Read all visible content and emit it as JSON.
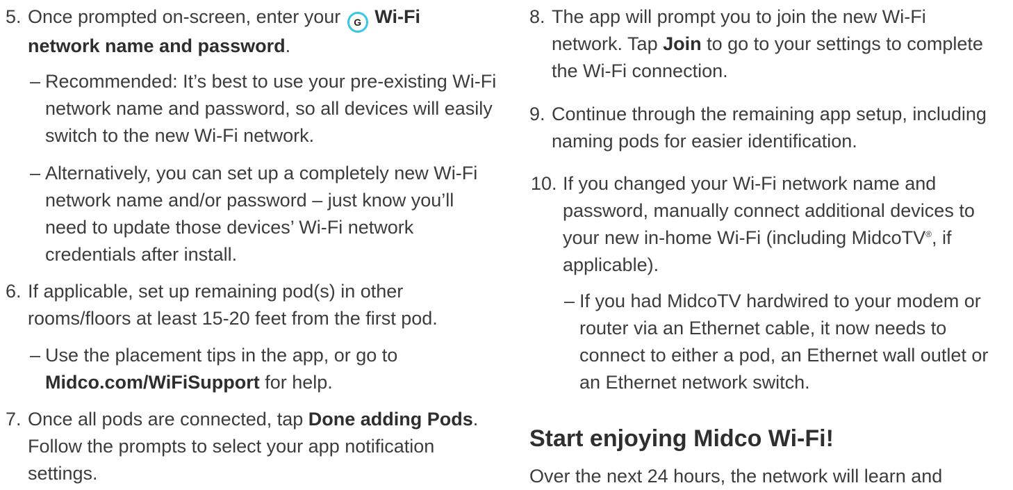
{
  "left": {
    "step5": {
      "num": "5.",
      "text_before": "Once prompted on-screen, enter your",
      "icon_letter": "G",
      "bold_1": "Wi-Fi",
      "bold_2": "network name and password",
      "text_after": "."
    },
    "step5_subs": [
      "Recommended: It’s best to use your pre-existing Wi-Fi network name and password, so all devices will easily switch to the new Wi-Fi network.",
      "Alternatively, you can set up a completely new Wi-Fi network name and/or password – just know you’ll need to update those devices’ Wi-Fi network credentials after install."
    ],
    "step6": {
      "num": "6.",
      "text": "If applicable, set up remaining pod(s) in other rooms/floors at least 15-20 feet from the first pod."
    },
    "step6_sub": {
      "text_before": "Use the placement tips in the app, or go to",
      "bold": "Midco.com/WiFiSupport",
      "text_after": "for help."
    },
    "step7": {
      "num": "7.",
      "text_before": "Once all pods are connected, tap",
      "bold": "Done adding Pods",
      "text_after": ". Follow the prompts to select your app notification settings."
    }
  },
  "right": {
    "step8": {
      "num": "8.",
      "text_before": "The app will prompt you to join the new Wi-Fi network. Tap",
      "bold": "Join",
      "text_after": "to go to your settings to complete the Wi-Fi connection."
    },
    "step9": {
      "num": "9.",
      "text": "Continue through the remaining app setup, including naming pods for easier identification."
    },
    "step10": {
      "num": "10.",
      "text_before": "If you changed your Wi-Fi network name and password, manually connect additional devices to your new in-home Wi-Fi (including MidcoTV",
      "reg": "®",
      "text_after": ", if applicable)."
    },
    "step10_sub": "If you had MidcoTV hardwired to your modem or router via an Ethernet cable, it now needs to connect to either a pod, an Ethernet wall outlet or an Ethernet network switch.",
    "heading": "Start enjoying Midco Wi-Fi!",
    "closing_text": "Over the next 24 hours, the network will learn and"
  },
  "dash_glyph": "–",
  "colors": {
    "text": "#3c3c3c",
    "icon_ring": "#38c6e8"
  }
}
